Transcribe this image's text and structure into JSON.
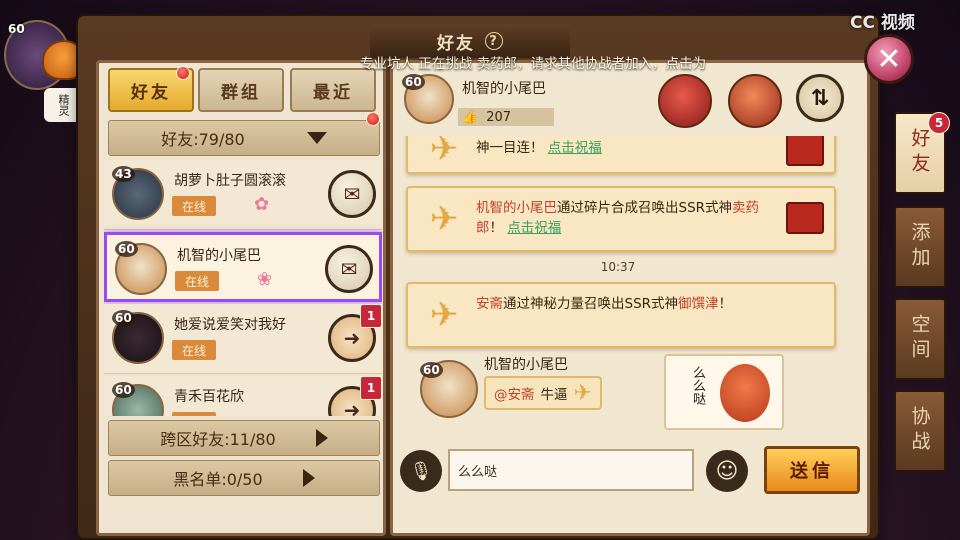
{
  "window": {
    "title": "好友",
    "help_icon": "?",
    "marquee": "专业坑人 正在挑战 卖药郎，请求其他协战者加入，点击为",
    "close_icon": "✕",
    "watermark": "CC 视频"
  },
  "player": {
    "level": "60",
    "mascot_label": "精灵"
  },
  "tabs": [
    {
      "label": "好友",
      "active": true,
      "badge": true
    },
    {
      "label": "群组",
      "active": false
    },
    {
      "label": "最近",
      "active": false
    }
  ],
  "friend_count": {
    "label": "好友:79/80"
  },
  "friends": [
    {
      "level": "43",
      "name": "胡萝卜肚子圆滚滚",
      "status": "在线",
      "action_icon": "gift-icon",
      "badge": ""
    },
    {
      "level": "60",
      "name": "机智的小尾巴",
      "status": "在线",
      "action_icon": "gift-icon",
      "selected": true,
      "badge": ""
    },
    {
      "level": "60",
      "name": "她爱说爱笑对我好",
      "status": "在线",
      "action_icon": "send-gift-icon",
      "badge": "1"
    },
    {
      "level": "60",
      "name": "青禾百花欣",
      "status": "在线",
      "action_icon": "send-gift-icon",
      "badge": "1"
    }
  ],
  "cross_server": {
    "label": "跨区好友:11/80"
  },
  "blacklist": {
    "label": "黑名单:0/50"
  },
  "chat": {
    "partner_level": "60",
    "partner_name": "机智的小尾巴",
    "likes": "207",
    "messages": [
      {
        "prefix": "神一目连！",
        "link": "点击祝福"
      },
      {
        "name": "机智的小尾巴",
        "text": "通过碎片合成召唤出SSR式神",
        "target": "卖药郎",
        "link": "点击祝福"
      },
      {
        "time": "10:37"
      },
      {
        "name": "安斋",
        "text": "通过神秘力量召唤出SSR式神",
        "target": "御馔津",
        "suffix": "！"
      }
    ],
    "reply": {
      "level": "60",
      "sender": "机智的小尾巴",
      "mention": "@安斋",
      "text": "牛逼",
      "sticker_text": "么么哒"
    },
    "input_value": "么么哒",
    "send_label": "送信"
  },
  "side_tabs": [
    {
      "label": "好友",
      "active": true,
      "badge": "5"
    },
    {
      "label": "添加",
      "active": false
    },
    {
      "label": "空间",
      "active": false
    },
    {
      "label": "协战",
      "active": false
    }
  ]
}
